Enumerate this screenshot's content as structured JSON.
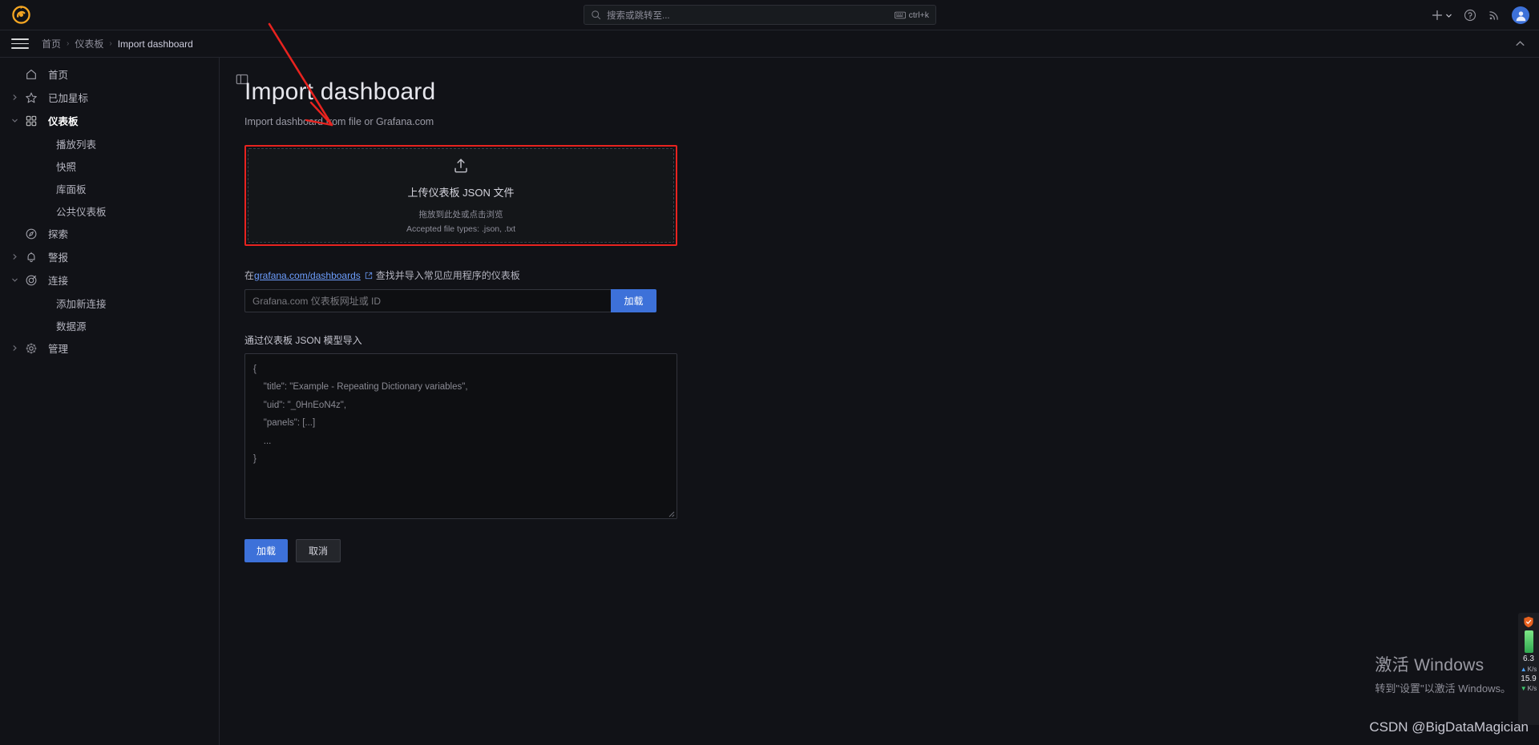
{
  "topbar": {
    "logo_icon": "grafana-logo-icon",
    "search": {
      "placeholder": "搜索或跳转至...",
      "icon": "search-icon",
      "shortcut": "ctrl+k",
      "shortcut_icon": "keyboard-icon"
    },
    "icons": {
      "add": "plus-icon",
      "add_chevron": "chevron-down-icon",
      "help": "help-circle-icon",
      "news": "rss-icon",
      "profile": "avatar-user-icon"
    }
  },
  "breadcrumb": {
    "menu_icon": "hamburger-menu-icon",
    "items": [
      {
        "label": "首页",
        "current": false
      },
      {
        "label": "仪表板",
        "current": false
      },
      {
        "label": "Import dashboard",
        "current": true
      }
    ],
    "separator": "›",
    "collapse_icon": "chevron-up-icon"
  },
  "sidebar": {
    "items": [
      {
        "label": "首页",
        "icon": "home-icon",
        "expander": "",
        "child": false,
        "active": false
      },
      {
        "label": "已加星标",
        "icon": "star-icon",
        "expander": "right",
        "child": false,
        "active": false
      },
      {
        "label": "仪表板",
        "icon": "dashboards-grid-icon",
        "expander": "down",
        "child": false,
        "active": true
      },
      {
        "label": "播放列表",
        "icon": "",
        "expander": "",
        "child": true,
        "active": false
      },
      {
        "label": "快照",
        "icon": "",
        "expander": "",
        "child": true,
        "active": false
      },
      {
        "label": "库面板",
        "icon": "",
        "expander": "",
        "child": true,
        "active": false
      },
      {
        "label": "公共仪表板",
        "icon": "",
        "expander": "",
        "child": true,
        "active": false
      },
      {
        "label": "探索",
        "icon": "compass-icon",
        "expander": "",
        "child": false,
        "active": false
      },
      {
        "label": "警报",
        "icon": "bell-icon",
        "expander": "right",
        "child": false,
        "active": false
      },
      {
        "label": "连接",
        "icon": "connections-icon",
        "expander": "down",
        "child": false,
        "active": false
      },
      {
        "label": "添加新连接",
        "icon": "",
        "expander": "",
        "child": true,
        "active": false
      },
      {
        "label": "数据源",
        "icon": "",
        "expander": "",
        "child": true,
        "active": false
      },
      {
        "label": "管理",
        "icon": "gear-icon",
        "expander": "right",
        "child": false,
        "active": false
      }
    ]
  },
  "main": {
    "panel_toggle_icon": "panel-toggle-icon",
    "title": "Import dashboard",
    "subtitle": "Import dashboard from file or Grafana.com",
    "dropzone": {
      "upload_icon": "upload-icon",
      "title": "上传仪表板 JSON 文件",
      "hint": "拖放到此处或点击浏览",
      "accepted": "Accepted file types: .json, .txt"
    },
    "gcom": {
      "prefix": "在",
      "link_text": "grafana.com/dashboards",
      "external_icon": "external-link-icon",
      "suffix": "查找并导入常见应用程序的仪表板"
    },
    "url_field": {
      "placeholder": "Grafana.com 仪表板网址或 ID",
      "value": "",
      "load_label": "加载"
    },
    "json_section": {
      "label": "通过仪表板 JSON 模型导入",
      "placeholder": "{\n    \"title\": \"Example - Repeating Dictionary variables\",\n    \"uid\": \"_0HnEoN4z\",\n    \"panels\": [...]\n    ...\n}",
      "value": ""
    },
    "actions": {
      "load_label": "加载",
      "cancel_label": "取消"
    }
  },
  "annotations": {
    "arrow_color": "#e8231f",
    "rect_color": "#e8231f"
  },
  "net_widget": {
    "shield_icon": "shield-icon",
    "upload_value": "6.3",
    "upload_unit": "K/s",
    "download_value": "15.9",
    "download_unit": "K/s"
  },
  "watermark": {
    "title": "激活 Windows",
    "subtitle": "转到\"设置\"以激活 Windows。"
  },
  "footer_credit": "CSDN @BigDataMagician"
}
